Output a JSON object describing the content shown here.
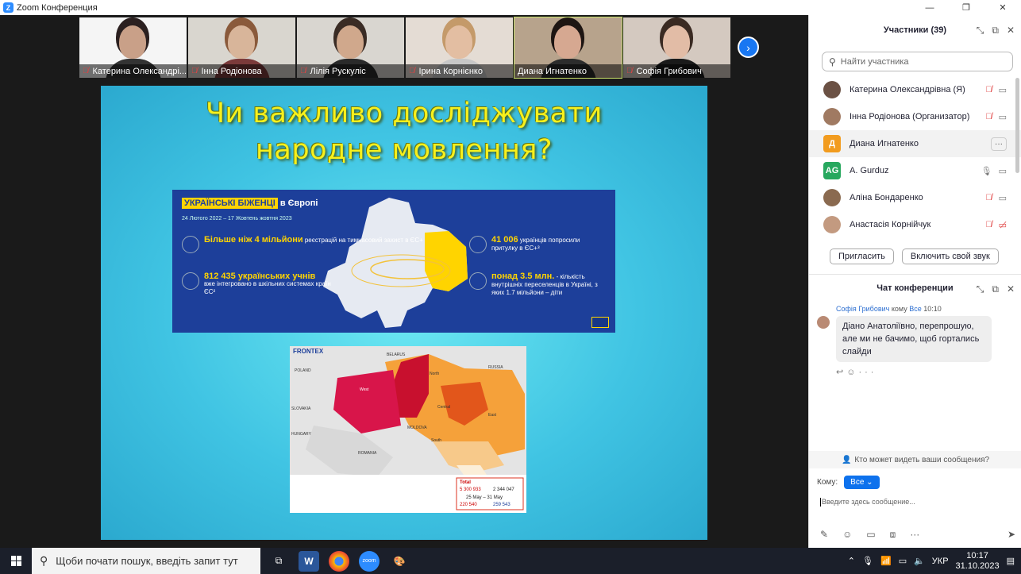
{
  "window": {
    "title": "Zoom Конференция",
    "logo": "Z"
  },
  "video_strip": {
    "tiles": [
      {
        "name": "Катерина Олександрі...",
        "muted": true,
        "bg": "#f5f5f5",
        "skin": "#c9a088",
        "hair": "#2b2020",
        "shirt": "#333"
      },
      {
        "name": "Інна Родіонова",
        "muted": true,
        "bg": "#d9d6cf",
        "skin": "#d8b59a",
        "hair": "#8a5a3b",
        "shirt": "#7b3a3a"
      },
      {
        "name": "Лілія Рускуліс",
        "muted": true,
        "bg": "#d9d6d0",
        "skin": "#d0a88c",
        "hair": "#3a2c25",
        "shirt": "#2a2a2a"
      },
      {
        "name": "Ірина Корнієнко",
        "muted": true,
        "bg": "#e4dcd4",
        "skin": "#e3bea2",
        "hair": "#c49a6a",
        "shirt": "#c7c7c7"
      },
      {
        "name": "Диана Игнатенко",
        "muted": false,
        "bg": "#b7a38c",
        "skin": "#d6a891",
        "hair": "#1d1512",
        "shirt": "#2c2c2c",
        "active": true
      },
      {
        "name": "Софія Грибович",
        "muted": true,
        "bg": "#d4c9c0",
        "skin": "#e2bca6",
        "hair": "#3a2a22",
        "shirt": "#1a1a1a"
      }
    ]
  },
  "slide": {
    "title_line1": "Чи важливо досліджувати",
    "title_line2": "народне мовлення?",
    "refugees": {
      "header_highlight": "УКРАЇНСЬКІ БІЖЕНЦІ",
      "header_rest": " в Європі",
      "date": "24 Лютого 2022 – 17 Жовтень жовтня 2023",
      "stats": [
        {
          "big": "Більше ніж 4 мільйони",
          "text": " реєстрацій на тимчасовий захист в ЄС+"
        },
        {
          "big": "812 435 українських учнів",
          "text": "вже інтегровано в шкільних системах країн ЄС²"
        },
        {
          "big": "41 006",
          "text": " українців попросили притулку в ЄС+³"
        },
        {
          "big": "понад 3.5 млн.",
          "text": " - кількість внутрішніх переселенців в Україні, з яких 1.7 мільйони – діти"
        }
      ]
    },
    "frontex": {
      "label": "FRONTEX",
      "total_label": "Total",
      "entering": "5 300 933",
      "leaving": "2 344 047",
      "period": "25 May – 31 May",
      "period_in": "220 540",
      "period_out": "259 543",
      "countries": [
        "BELARUS",
        "RUSSIA",
        "POLAND",
        "SLOVAKIA",
        "HUNGARY",
        "ROMANIA",
        "MOLDOVA"
      ],
      "regions": [
        "North",
        "Central",
        "East",
        "South",
        "West"
      ]
    }
  },
  "participants_panel": {
    "title": "Участники (39)",
    "search_placeholder": "Найти участника",
    "items": [
      {
        "name": "Катерина Олександрівна (Я)",
        "avatar_type": "photo",
        "avatar_color": "#6b5144",
        "mic": "muted",
        "video": "on"
      },
      {
        "name": "Інна Родіонова (Организатор)",
        "avatar_type": "photo",
        "avatar_color": "#a07a62",
        "mic": "muted",
        "video": "on"
      },
      {
        "name": "Диана Игнатенко",
        "avatar_type": "letter",
        "letter": "Д",
        "avatar_color": "#f29c1f",
        "highlight": true,
        "more": "···"
      },
      {
        "name": "A. Gurduz",
        "avatar_type": "letter",
        "letter": "AG",
        "avatar_color": "#27a85e",
        "mic": "on",
        "video": "on"
      },
      {
        "name": "Аліна Бондаренко",
        "avatar_type": "photo",
        "avatar_color": "#8a6a50",
        "mic": "muted",
        "video": "on"
      },
      {
        "name": "Анастасія Корнійчук",
        "avatar_type": "photo",
        "avatar_color": "#c39a80",
        "mic": "muted",
        "video": "off"
      }
    ],
    "invite_label": "Пригласить",
    "unmute_label": "Включить свой звук"
  },
  "chat_panel": {
    "title": "Чат конференции",
    "message": {
      "sender": "Софія Грибович",
      "to_word": "кому",
      "to": "Все",
      "time": "10:10",
      "text": "Діано Анатоліївно, перепрошую, але ми не бачимо, щоб гортались слайди"
    },
    "who_can_see": "Кто может видеть ваши сообщения?",
    "to_label": "Кому:",
    "to_value": "Все",
    "input_placeholder": "Введите здесь сообщение..."
  },
  "taskbar": {
    "search_placeholder": "Щоби почати пошук, введіть запит тут",
    "language": "УКР",
    "time": "10:17",
    "date": "31.10.2023"
  }
}
